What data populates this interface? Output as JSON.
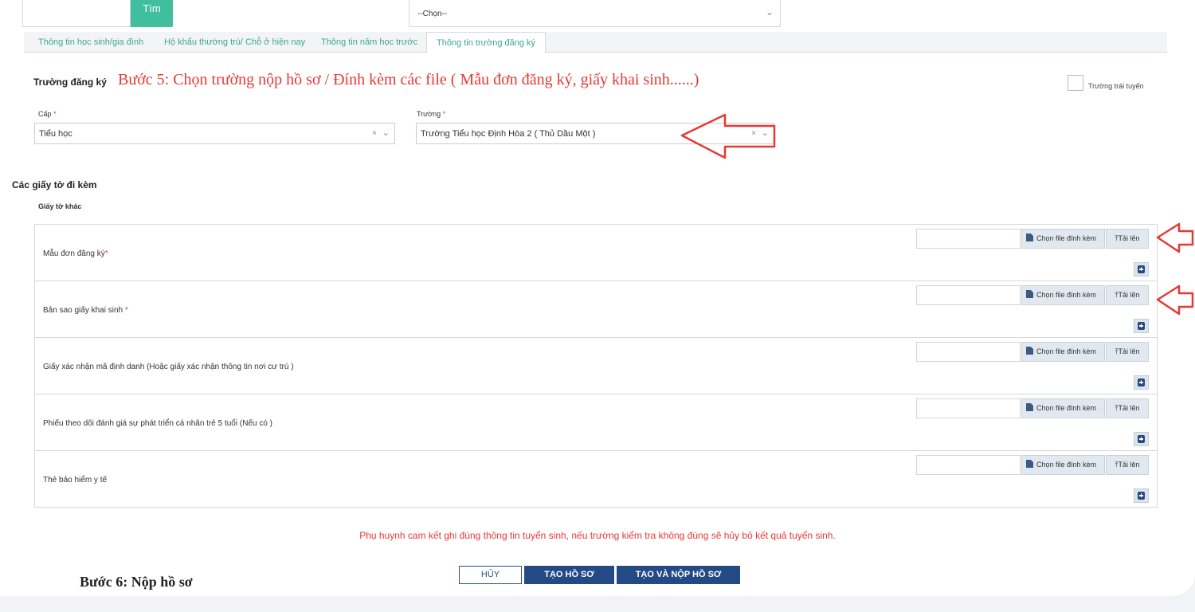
{
  "search": {
    "button_label": "Tìm",
    "select_value": "--Chọn--"
  },
  "tabs": [
    {
      "label": "Thông tin học sinh/gia đình"
    },
    {
      "label": "Hộ khẩu thường trú/ Chỗ ở hiện nay"
    },
    {
      "label": "Thông tin năm học trước"
    },
    {
      "label": "Thông tin trường đăng ký"
    }
  ],
  "section": {
    "title": "Trường đăng ký",
    "step5_note": "Bước 5: Chọn trường nộp hồ sơ / Đính kèm các file ( Mẫu đơn đăng ký, giấy khai sinh......)",
    "checkbox_label": "Trường trái tuyến"
  },
  "fields": {
    "cap": {
      "label": "Cấp",
      "value": "Tiểu học"
    },
    "truong": {
      "label": "Trường",
      "value": "Trường Tiểu học Định Hòa 2 ( Thủ Dầu Một )"
    },
    "required_mark": "*",
    "clear_glyph": "×"
  },
  "attachments": {
    "title": "Các giấy tờ đi kèm",
    "subtitle": "Giấy tờ khác",
    "choose_label": "Chọn file đính kèm",
    "upload_label": "Tải lên",
    "items": [
      {
        "name": "Mẫu đơn đăng ký",
        "required": "*"
      },
      {
        "name": "Bản sao giấy khai sinh ",
        "required": "*"
      },
      {
        "name": "Giấy xác nhận mã định danh (Hoặc giấy xác nhận thông tin nơi cư trú )",
        "required": ""
      },
      {
        "name": "Phiếu theo dõi đánh giá sự phát triển cá nhân trẻ 5 tuổi (Nếu có )",
        "required": ""
      },
      {
        "name": "Thẻ bảo hiểm y tế",
        "required": ""
      }
    ]
  },
  "commitment": "Phụ huynh cam kết ghi đúng thông tin tuyển sinh, nếu trường kiểm tra không đúng sẽ hủy bỏ kết quả tuyển sinh.",
  "actions": {
    "cancel": "HỦY",
    "create": "TẠO HỒ SƠ",
    "create_submit": "TẠO VÀ NỘP HỒ SƠ"
  },
  "step6_note": "Bước 6: Nộp hồ sơ",
  "colors": {
    "accent": "#3fbf9e",
    "primary": "#234a85",
    "annotation": "#e53935"
  }
}
